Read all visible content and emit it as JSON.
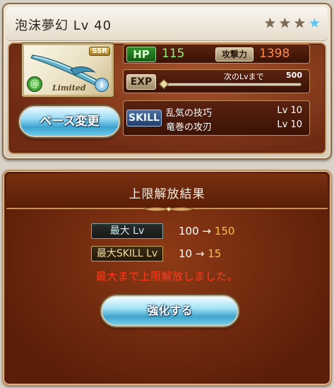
{
  "weapon": {
    "title": "泡沫夢幻 Lv 40",
    "rarity_badge": "SSR",
    "limited_label": "Limited",
    "info_glyph": "i",
    "element_glyph": "@",
    "stars": [
      {
        "icon": "bronze-star",
        "glyph": "★"
      },
      {
        "icon": "bronze-star",
        "glyph": "★"
      },
      {
        "icon": "bronze-star",
        "glyph": "★"
      },
      {
        "icon": "blue-star",
        "glyph": "★"
      }
    ]
  },
  "stats": {
    "hp_label": "HP",
    "hp_value": "115",
    "atk_label": "攻撃力",
    "atk_value": "1398",
    "exp_label": "EXP",
    "exp_next_label": "次のLvまで",
    "exp_next_value": "500",
    "exp_progress": 0.0,
    "skill_label": "SKILL",
    "skills": [
      {
        "name": "乱気の技巧",
        "lv": "Lv 10"
      },
      {
        "name": "竜巻の攻刃",
        "lv": "Lv 10"
      }
    ]
  },
  "buttons": {
    "base_change": "ベース変更",
    "upgrade": "強化する"
  },
  "result": {
    "title": "上限解放結果",
    "max_lv_label": "最大 Lv",
    "max_lv_old": "100",
    "max_lv_new": "150",
    "max_skill_label": "最大SKILL Lv",
    "max_skill_old": "10",
    "max_skill_new": "15",
    "arrow": "→",
    "message": "最大まで上限解放しました。"
  },
  "colors": {
    "hp_green": "#8ff07c",
    "atk_orange": "#ff8a4a",
    "new_value_gold": "#f6c24a",
    "message_red": "#ff3b1f",
    "panel_brown": "#6e2a12"
  }
}
